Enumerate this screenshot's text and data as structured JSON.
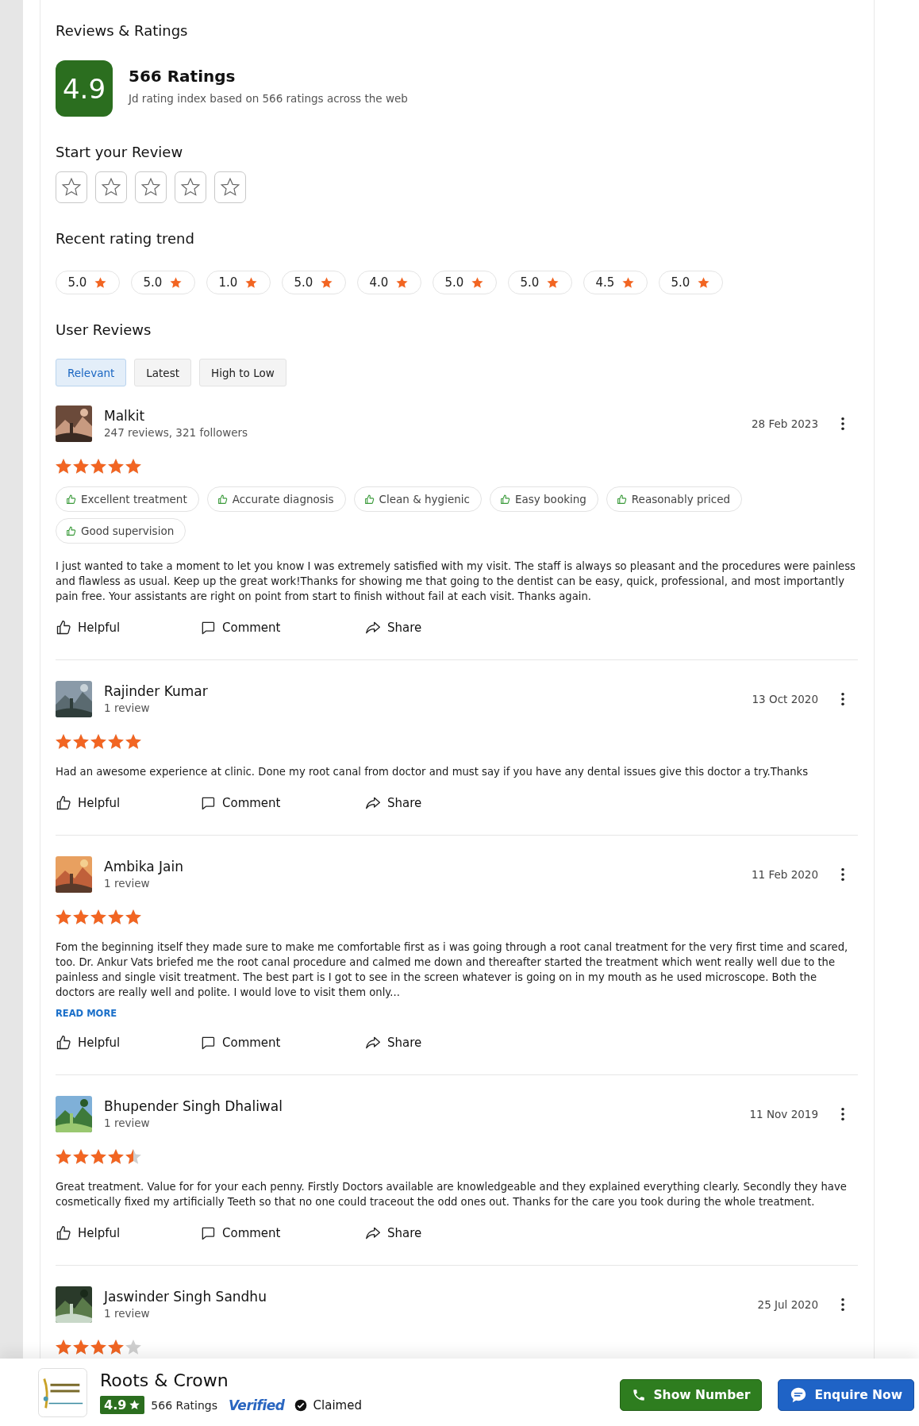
{
  "section_title": "Reviews & Ratings",
  "summary": {
    "score": "4.9",
    "count": "566 Ratings",
    "caption": "Jd rating index based on 566 ratings across the web"
  },
  "start_review": {
    "title": "Start your Review"
  },
  "trend": {
    "title": "Recent rating trend",
    "chips": [
      "5.0",
      "5.0",
      "1.0",
      "5.0",
      "4.0",
      "5.0",
      "5.0",
      "4.5",
      "5.0"
    ]
  },
  "user_reviews": {
    "title": "User Reviews",
    "sort_tabs": [
      {
        "label": "Relevant",
        "selected": true
      },
      {
        "label": "Latest",
        "selected": false
      },
      {
        "label": "High to Low",
        "selected": false
      }
    ]
  },
  "reviews": [
    {
      "name": "Malkit",
      "meta": "247 reviews, 321 followers",
      "date": "28 Feb 2023",
      "stars": 5,
      "tags": [
        "Excellent treatment",
        "Accurate diagnosis",
        "Clean & hygienic",
        "Easy booking",
        "Reasonably priced",
        "Good supervision"
      ],
      "text": "I just wanted to take a moment to let you know I was extremely satisfied with my visit. The staff is always so pleasant and the procedures were painless and flawless as usual. Keep up the great work!Thanks for showing me that going to the dentist can be easy, quick, professional, and most importantly pain free. Your assistants are right on point from start to finish without fail at each visit. Thanks again.",
      "actions": [
        "Helpful",
        "Comment",
        "Share"
      ]
    },
    {
      "name": "Rajinder Kumar",
      "meta": "1 review",
      "date": "13 Oct 2020",
      "stars": 5,
      "text": "Had an awesome experience at clinic. Done my root canal from doctor and must say if you have any dental issues give this doctor a try.Thanks",
      "actions": [
        "Helpful",
        "Comment",
        "Share"
      ]
    },
    {
      "name": "Ambika Jain",
      "meta": "1 review",
      "date": "11 Feb 2020",
      "stars": 5,
      "text": "Fom the beginning itself they made sure to make me comfortable first as i was going through a root canal treatment for the very first time and scared, too. Dr. Ankur Vats briefed me the root canal procedure and calmed me down and thereafter started the treatment which went really well due to the painless and single visit treatment. The best part is I got to see in the screen whatever is going on in my mouth as he used microscope. Both the doctors are really well and polite. I would love to visit them only...",
      "read_more": "READ MORE",
      "actions": [
        "Helpful",
        "Comment",
        "Share"
      ]
    },
    {
      "name": "Bhupender Singh Dhaliwal",
      "meta": "1 review",
      "date": "11 Nov 2019",
      "stars": 4.5,
      "text": "Great treatment. Value for for your each penny. Firstly Doctors available are knowledgeable and they explained everything clearly. Secondly they have cosmetically fixed my artificially Teeth so that no one could traceout the odd ones out. Thanks for the care you took during the whole treatment.",
      "actions": [
        "Helpful",
        "Comment",
        "Share"
      ]
    },
    {
      "name": "Jaswinder Singh Sandhu",
      "meta": "1 review",
      "date": "25 Jul 2020",
      "stars": 4
    }
  ],
  "bottom_bar": {
    "name": "Roots & Crown",
    "score": "4.9",
    "ratings": "566 Ratings",
    "verified": "Verified",
    "claimed": "Claimed",
    "buttons": [
      {
        "label": "Show Number",
        "kind": "phone"
      },
      {
        "label": "Enquire Now",
        "kind": "chat"
      }
    ]
  }
}
